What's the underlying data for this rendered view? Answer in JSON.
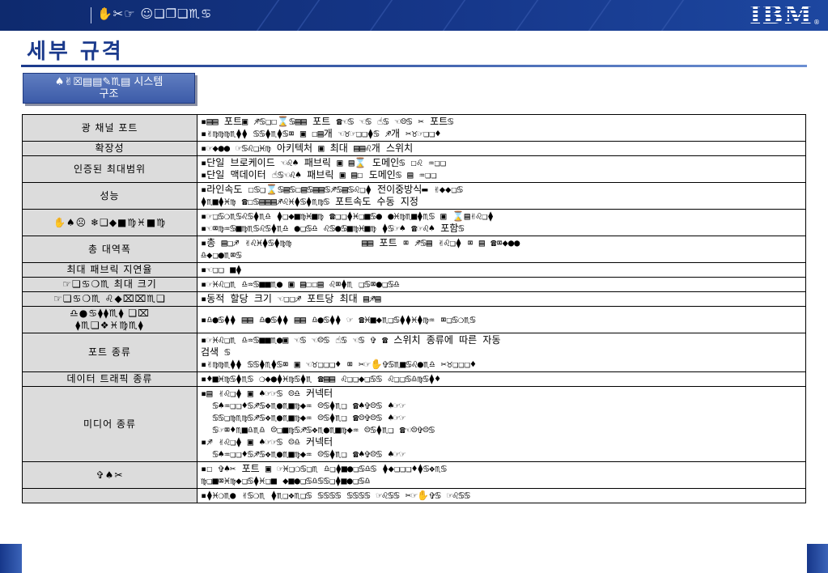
{
  "header": {
    "text": "✋✂☞ ☺❏❐❏♏♋",
    "logo": "IBM",
    "registered": "®"
  },
  "page_title": "세부  규격",
  "section_label": "♠✌☒▤▤✎♏▤ 시스템\n구조",
  "colors": {
    "header_bg": "#16378a",
    "title_color": "#1b3a8c",
    "key_cell_bg": "#dcdcdc"
  },
  "rows": [
    {
      "key": "광 채널 포트",
      "lines": [
        "▪▤▤ 포트▣ ♐♋❏☐⌛♋▤▤ 포트 ☎☜♋ ☜♋ ☝♋ ☜☹♋ ✂ 포트♋",
        "▪✌♍♍♍♏⧫⧫ ♋♋⧫♏⧫♋⌧ ▣ ☐▤개 ☜♉☞❏❏⧫♋ ♐개 ✂♉☞❏❏♦"
      ]
    },
    {
      "key": "확장성",
      "lines": [
        "▪☞◆●● ☞♋♌❏♓♍ 아키텍처 ▣ 최대 ▤▤♌개 스위치"
      ]
    },
    {
      "key": "인증된 최대범위",
      "lines": [
        "▪단일 브로케이드 ☜♌♠ 패브릭 ▣ ▤⌛ 도메인♋ ☐♌ ♒❏❏",
        "▪단일 맥데이터 ☝♋☜♌♠ 패브릭 ▣ ▤☐ 도메인♋ ▤ ♒❏❏"
      ]
    },
    {
      "key": "성능",
      "lines": [
        "▪라인속도 ☐♋❏⌛♋▤♋☐▤♋▤▤♋♐♋▤♋♌❏⧫ 전이중방식▬ ✌◆◆❏♋",
        "⧫♏■⧫♓♍ ☎☐♋▤▤▤♐♌♓⧫♋⧫♏♍♋ 포트속도 수동 지정"
      ]
    },
    {
      "key": "✋♠☹ ❄❏◆■♍♓■♍",
      "lines": [
        "▪☞❏♋❍♏♋♌♋⧫♏♎ ⧫❏◆■♍♓■♍ ☎❏❏⧫♓❏■♋● ●♓♍♏■⧫♏♋ ▣ ⌛▤✌♌❏⧫",
        "▪☜⌧♍♒♋■♍♏♋♌♋⧫♏♎ ●❏♋♎ ♌♋●♋■♍♓■♍ ⧫♋☞♠ ☎☞♌♠ 포함♋"
      ]
    },
    {
      "key": "총 대역폭",
      "lines": [
        "▪총 ▤❏♐ ✌♌♓⧫♋⧫♍♍            ▤▤ 포트 ⌧ ♐♋▤ ✌♌❏⧫ ⌧ ▤ ☎⌧◆●●",
        "♎◆❏●♏⌧♋"
      ]
    },
    {
      "key": "최대 패브릭 지연율",
      "lines": [
        "▪☜❏❏ ■⧫"
      ]
    },
    {
      "key": "☞❏♋❍♏ 최대 크기",
      "lines": [
        "▪☞♓♌❏♏ ♎♒♋■■♏● ▣ ▤☐☐▤ ♌⌧⧫♏ ❏♋⌧●❏♋♎"
      ]
    },
    {
      "key": "☞❏♋❍♏ ♌◆⌧⌧♏❏",
      "lines": [
        "▪동적 할당 크기 ☜❏❏♐ 포트당 최대 ▤♐▤"
      ]
    },
    {
      "key": "♎●♋⧫⧫♏⧫ ❏⌧\n⧫♏❏❖♓♍♏⧫",
      "lines": [
        "▪♎●♋⧫⧫ ▤▤ ♎●♋⧫⧫ ▤▤ ♎●♋⧫⧫ ☞ ☎♓■◆♏❏♋⧫⧫♓⧫♍♒ ⌧❏♋❍♏♋"
      ]
    },
    {
      "key": "포트 종류",
      "lines": [
        "▪☞♓♌❏♏ ♎♒♋■■♏●▣ ☜♋ ☜☹♋ ☝♋ ☜♋ ✞ ☎ 스위치 종류에 따른 자동",
        "검색 ♋",
        "▪✌♍♍♏⧫⧫ ♋♋⧫♏⧫♋⌧ ▣ ☜♉❏❏❏♦ ⌧ ✂☞✋✞♋♏■♋♌●♏♎ ✂♉❏❏❏♦"
      ]
    },
    {
      "key": "데이터 트래픽 종류",
      "lines": [
        "▪♦■♓♍♋⧫♏♋ ❍◆●⧫♓♍♋⧫♏ ☎▤▤ ♌❏❏◆❏♋♋ ♌❏❏♋♎♍♋⧫♦"
      ]
    },
    {
      "key": "미디어 종류",
      "lines": [
        "▪▤ ✌♌❏⧫ ▣ ♠☞☞♋ ☹♎ 커넥터",
        "  ♋♠♒❏❏♦♋♐♋❖♏●♏■♍◆♒ ☹♋⧫♏❏ ☎♠✞☹♋ ♠☞☞",
        "  ♋♋❏♍♏♍♋♐♋❖♏●♏■♍◆♒ ☹♋⧫♏❏ ☎☹✞☹♋ ♠☞☞",
        "  ♋☞⌧♦♏■♎♏♎ ☹❏■♍♋♐♋❖♏●♏■♍◆♒ ☹♋⧫♏❏ ☎☜☹✞☹♋",
        "▪♐ ✌♌❏⧫ ▣ ♠☞☞♋ ☹♎ 커넥터",
        "  ♋♠♒❏❏♦♋♐♋❖♏●♏■♍◆♒ ☹♋⧫♏❏ ☎♠✞☹♋ ♠☞☞"
      ]
    },
    {
      "key": "✞♠✂",
      "lines": [
        "▪☐ ✞♠✂ 포트 ▣ ☞♓❏❍♋❏♏ ♎❏⧫■●❏♋♎♋ ⧫◆❏❏❏♦⧫♋❖♏♋",
        "♍❏■⌧♓♍◆❏♋⧫♓❏■ ◆■●❏♋♎♋♋❏⧫■●❏♋♎"
      ]
    },
    {
      "key": "",
      "lines": [
        "▪⧫♓❍♏● ✌♋❍♏ ⧫♏❏❖♏❏♋ ♋♋♋♋ ♋♋♋♋ ☞♌♋♋ ✂☞✋✞♋ ☞♌♋♋"
      ]
    }
  ]
}
